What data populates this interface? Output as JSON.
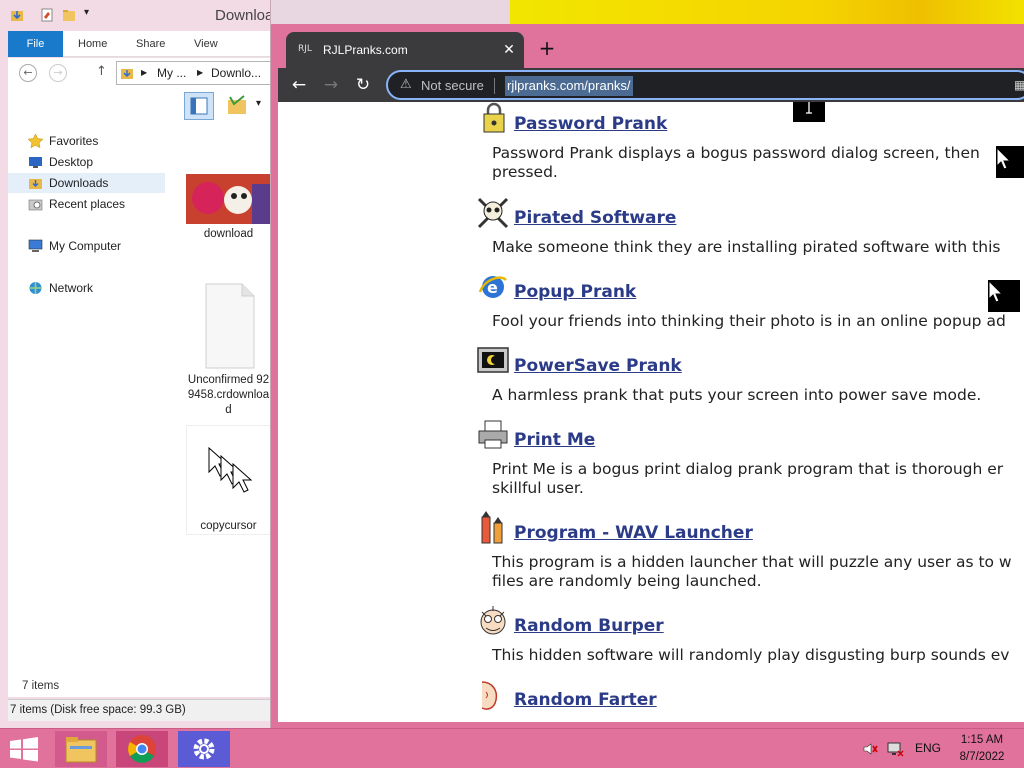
{
  "explorer": {
    "title": "Downloads",
    "window_buttons": {
      "minimize": "▬",
      "maximize": "□",
      "close": "✖"
    },
    "ribbon_tabs": [
      "File",
      "Home",
      "Share",
      "View"
    ],
    "address_parts": [
      "My ...",
      "Downlo..."
    ],
    "nav_items": [
      {
        "label": "Favorites",
        "icon": "star-icon"
      },
      {
        "label": "Desktop",
        "icon": "desktop-icon"
      },
      {
        "label": "Downloads",
        "icon": "folder-icon"
      },
      {
        "label": "Recent places",
        "icon": "recent-places-icon"
      },
      {
        "label": "My Computer",
        "icon": "computer-icon"
      },
      {
        "label": "Network",
        "icon": "network-icon"
      }
    ],
    "files": [
      {
        "caption": "download"
      },
      {
        "caption": "Unconfirmed 929458.crdownload"
      },
      {
        "caption": "copycursor"
      }
    ],
    "status_count": "7 items",
    "status_detail": "7 items (Disk free space: 99.3 GB)"
  },
  "chrome": {
    "tab_favicon": "RJL",
    "tab_title": "RJLPranks.com",
    "tab_close": "✕",
    "new_tab": "+",
    "back": "←",
    "forward": "→",
    "reload": "↻",
    "not_secure": "Not secure",
    "url": "rjlpranks.com/pranks/"
  },
  "pranks": [
    {
      "title": "Password Prank",
      "desc": "Password Prank displays a bogus password dialog screen, then",
      "desc2": "pressed.",
      "icon": "lock-icon"
    },
    {
      "title": "Pirated Software",
      "desc": "Make someone think they are installing pirated software with this",
      "desc2": "",
      "icon": "skull-icon"
    },
    {
      "title": "Popup Prank",
      "desc": "Fool your friends into thinking their photo is in an online popup ad",
      "desc2": "",
      "icon": "ie-icon"
    },
    {
      "title": "PowerSave Prank",
      "desc": "A harmless prank that puts your screen into power save mode.",
      "desc2": "",
      "icon": "monitor-icon"
    },
    {
      "title": "Print Me",
      "desc": "Print Me is a bogus print dialog prank program that is thorough er",
      "desc2": "skillful user.",
      "icon": "printer-icon"
    },
    {
      "title": "Program - WAV Launcher",
      "desc": "This program is a hidden launcher that will puzzle any user as to w",
      "desc2": "files are randomly being launched.",
      "icon": "rocket-icon"
    },
    {
      "title": "Random Burper",
      "desc": "This hidden software will randomly play disgusting burp sounds ev",
      "desc2": "",
      "icon": "face-icon"
    },
    {
      "title": "Random Farter",
      "desc": "",
      "desc2": "",
      "icon": "farter-icon"
    }
  ],
  "taskbar": {
    "language": "ENG",
    "time": "1:15 AM",
    "date": "8/7/2022"
  }
}
